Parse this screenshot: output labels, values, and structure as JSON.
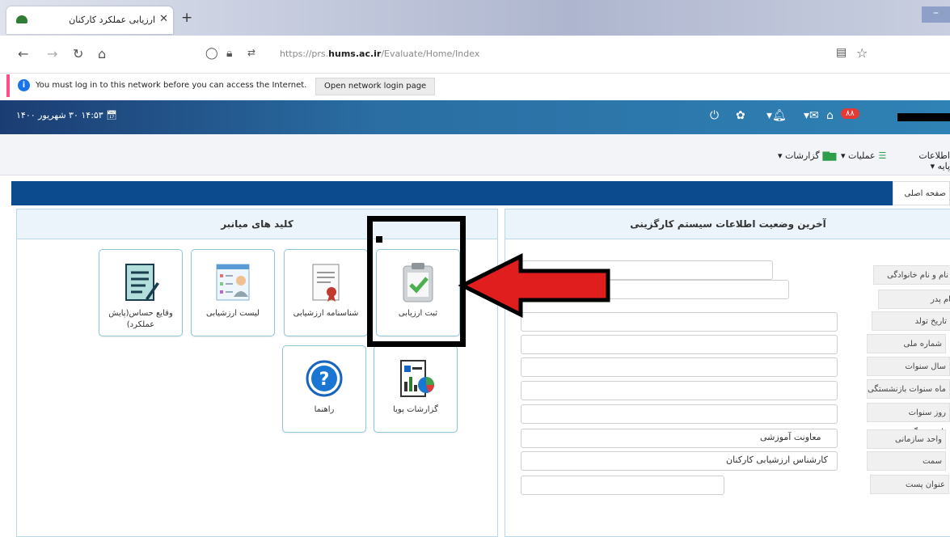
{
  "browser": {
    "tab_title": "ارزیابی عملکرد کارکنان",
    "tab_close": "✕",
    "new_tab": "+",
    "url_prefix": "https://prs.",
    "url_host": "hums.ac.ir",
    "url_path": "/Evaluate/Home/Index",
    "notification": "You must log in to this network before you can access the Internet.",
    "notification_button": "Open network login page"
  },
  "header": {
    "datetime": "۱۴:۵۳ ۳۰ شهریور ۱۴۰۰",
    "badge": "۸۸"
  },
  "menu": {
    "items": [
      {
        "label": "اطلاعات پایه ▾"
      },
      {
        "label": "عملیات ▾"
      },
      {
        "label": "گزارشات ▾"
      }
    ]
  },
  "breadcrumb": "صفحه اصلی",
  "left_panel": {
    "title": "کلید های میانبر",
    "tiles": [
      {
        "label": "ثبت ارزیابی",
        "icon": "clipboard-check-icon"
      },
      {
        "label": "شناسنامه ارزشیابی",
        "icon": "certificate-document-icon"
      },
      {
        "label": "لیست ارزشیابی",
        "icon": "user-list-icon"
      },
      {
        "label": "وقایع حساس(پایش عملکرد)",
        "icon": "notes-scroll-icon"
      },
      {
        "label": "گزارشات پویا",
        "icon": "dashboard-report-icon"
      },
      {
        "label": "راهنما",
        "icon": "help-icon"
      }
    ]
  },
  "right_panel": {
    "title": "آخرین وضعیت اطلاعات سیستم کارگزینی",
    "rows": [
      {
        "label": "نام و نام خانوادگی",
        "value": ""
      },
      {
        "label": "نام پدر",
        "value": ""
      },
      {
        "label": "تاریخ تولد",
        "value": ""
      },
      {
        "label": "شماره ملی",
        "value": ""
      },
      {
        "label": "سال سنوات بازنشستگی",
        "value": ""
      },
      {
        "label": "ماه سنوات بازنشستگی",
        "value": ""
      },
      {
        "label": "روز سنوات بازنشستگی",
        "value": ""
      },
      {
        "label": "واحد سازمانی",
        "value": "معاونت آموزشی"
      },
      {
        "label": "سمت",
        "value": "کارشناس ارزشیابی کارکنان"
      },
      {
        "label": "عنوان پست",
        "value": ""
      }
    ]
  },
  "colors": {
    "header_blue": "#1b3d73",
    "strip_blue": "#0c4b8e",
    "annotation_arrow": "#e01e1e",
    "tile_border": "#8fc7d8"
  }
}
